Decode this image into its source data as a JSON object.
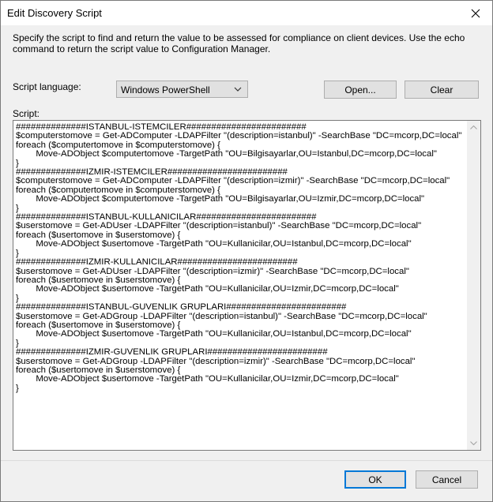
{
  "window": {
    "title": "Edit Discovery Script"
  },
  "description": "Specify the script to find and return the value to be assessed for compliance on client devices. Use the echo command to return the script value to Configuration Manager.",
  "script_language": {
    "label": "Script language:",
    "selected": "Windows PowerShell"
  },
  "buttons": {
    "open": "Open...",
    "clear": "Clear",
    "ok": "OK",
    "cancel": "Cancel"
  },
  "script": {
    "label": "Script:",
    "lines": [
      "##############ISTANBUL-ISTEMCILER########################",
      "$computerstomove = Get-ADComputer -LDAPFilter \"(description=istanbul)\" -SearchBase \"DC=mcorp,DC=local\"",
      "foreach ($computertomove in $computerstomove) {",
      "\tMove-ADObject $computertomove -TargetPath \"OU=Bilgisayarlar,OU=Istanbul,DC=mcorp,DC=local\"",
      "}",
      "##############IZMIR-ISTEMCILER########################",
      "$computerstomove = Get-ADComputer -LDAPFilter \"(description=izmir)\" -SearchBase \"DC=mcorp,DC=local\"",
      "foreach ($computertomove in $computerstomove) {",
      "\tMove-ADObject $computertomove -TargetPath \"OU=Bilgisayarlar,OU=Izmir,DC=mcorp,DC=local\"",
      "}",
      "##############ISTANBUL-KULLANICILAR########################",
      "$userstomove = Get-ADUser -LDAPFilter \"(description=istanbul)\" -SearchBase \"DC=mcorp,DC=local\"",
      "foreach ($usertomove in $userstomove) {",
      "\tMove-ADObject $usertomove -TargetPath \"OU=Kullanicilar,OU=Istanbul,DC=mcorp,DC=local\"",
      "}",
      "##############IZMIR-KULLANICILAR########################",
      "$userstomove = Get-ADUser -LDAPFilter \"(description=izmir)\" -SearchBase \"DC=mcorp,DC=local\"",
      "foreach ($usertomove in $userstomove) {",
      "\tMove-ADObject $usertomove -TargetPath \"OU=Kullanicilar,OU=Izmir,DC=mcorp,DC=local\"",
      "}",
      "##############ISTANBUL-GUVENLIK GRUPLARI########################",
      "$userstomove = Get-ADGroup -LDAPFilter \"(description=istanbul)\" -SearchBase \"DC=mcorp,DC=local\"",
      "foreach ($usertomove in $userstomove) {",
      "\tMove-ADObject $usertomove -TargetPath \"OU=Kullanicilar,OU=Istanbul,DC=mcorp,DC=local\"",
      "}",
      "##############IZMIR-GUVENLIK GRUPLARI########################",
      "$userstomove = Get-ADGroup -LDAPFilter \"(description=izmir)\" -SearchBase \"DC=mcorp,DC=local\"",
      "foreach ($usertomove in $userstomove) {",
      "\tMove-ADObject $usertomove -TargetPath \"OU=Kullanicilar,OU=Izmir,DC=mcorp,DC=local\"",
      "}"
    ]
  },
  "icons": {
    "close": "close-icon",
    "dropdown": "chevron-down-icon",
    "scroll_up": "scroll-up-arrow-icon",
    "scroll_down": "scroll-down-arrow-icon"
  },
  "colors": {
    "dialog_bg": "#f0f0f0",
    "button_bg": "#e1e1e1",
    "button_border": "#adadad",
    "default_button_border": "#0078d7"
  }
}
